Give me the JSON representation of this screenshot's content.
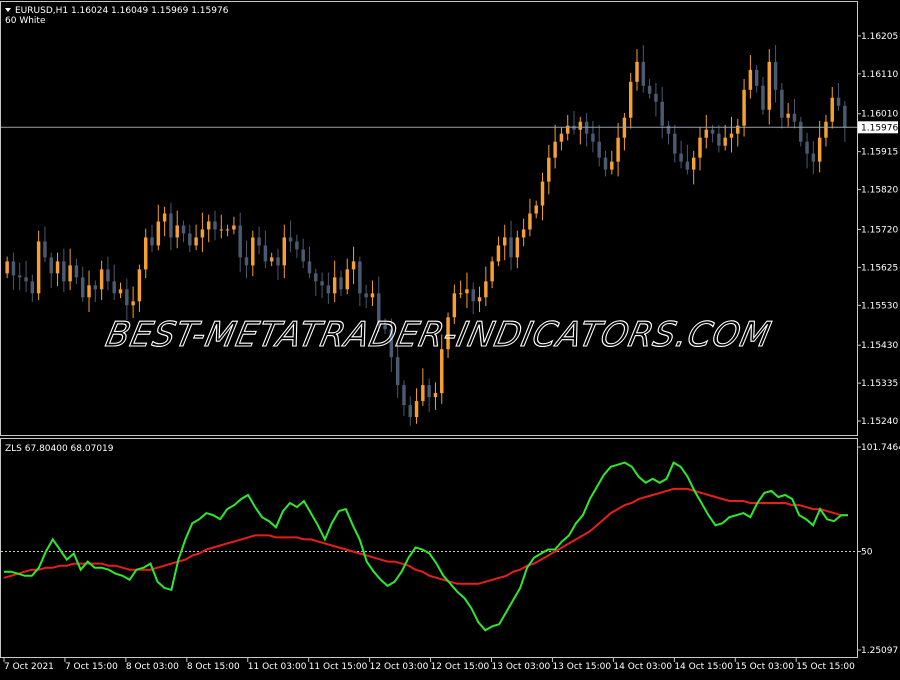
{
  "main_panel": {
    "symbol_header": "EURUSD,H1  1.16024 1.16049 1.15969 1.15976",
    "template_label": "60 White",
    "current_price": "1.15976",
    "price_line_value": 1.15976,
    "price_ticks": [
      "1.16205",
      "1.16110",
      "1.16010",
      "1.15915",
      "1.15820",
      "1.15720",
      "1.15625",
      "1.15530",
      "1.15430",
      "1.15335",
      "1.15240"
    ],
    "price_range": [
      1.15205,
      1.1629
    ],
    "watermark": "BEST-METATRADER-INDICATORS.COM"
  },
  "indicator_panel": {
    "label": "ZLS 67.80400 68.07019",
    "ticks": [
      "101.74647",
      "50",
      "1.25097"
    ],
    "range": [
      1.25097,
      101.74647
    ],
    "level": 50,
    "level_label": "50"
  },
  "time_axis": {
    "labels": [
      "7 Oct 2021",
      "7 Oct 15:00",
      "8 Oct 03:00",
      "8 Oct 15:00",
      "11 Oct 03:00",
      "11 Oct 15:00",
      "12 Oct 03:00",
      "12 Oct 15:00",
      "13 Oct 03:00",
      "13 Oct 15:00",
      "14 Oct 03:00",
      "14 Oct 15:00",
      "15 Oct 03:00",
      "15 Oct 15:00"
    ]
  },
  "colors": {
    "background": "#000000",
    "bull_candle": "#f5a030",
    "bear_candle": "#4a5a70",
    "grid_frame": "#c8c8c8",
    "text": "#ffffff",
    "zls_fast": "#2ee82e",
    "zls_slow": "#e61e1e",
    "watermark": "#ffffff"
  },
  "chart_data": [
    {
      "type": "candlestick",
      "title": "EURUSD,H1",
      "candles_close": [
        1.1564,
        1.15605,
        1.156,
        1.1559,
        1.1556,
        1.1569,
        1.1565,
        1.1561,
        1.1564,
        1.1559,
        1.1563,
        1.156,
        1.1555,
        1.1558,
        1.1557,
        1.1562,
        1.1559,
        1.1556,
        1.1557,
        1.1553,
        1.1554,
        1.1562,
        1.157,
        1.1568,
        1.1574,
        1.1576,
        1.157,
        1.1573,
        1.1571,
        1.1568,
        1.157,
        1.1572,
        1.1574,
        1.1572,
        1.1572,
        1.1572,
        1.1573,
        1.1565,
        1.1563,
        1.157,
        1.1568,
        1.1564,
        1.1565,
        1.1563,
        1.157,
        1.1569,
        1.1567,
        1.1564,
        1.1561,
        1.1559,
        1.1558,
        1.1556,
        1.156,
        1.1557,
        1.1562,
        1.1564,
        1.1556,
        1.1555,
        1.1556,
        1.1548,
        1.1547,
        1.154,
        1.1533,
        1.1528,
        1.1525,
        1.1529,
        1.1533,
        1.153,
        1.1531,
        1.1542,
        1.155,
        1.1556,
        1.1556,
        1.1557,
        1.1554,
        1.1555,
        1.1559,
        1.1564,
        1.1568,
        1.157,
        1.1565,
        1.157,
        1.1572,
        1.1576,
        1.1578,
        1.1584,
        1.159,
        1.1594,
        1.1596,
        1.1598,
        1.1597,
        1.1599,
        1.1596,
        1.1594,
        1.159,
        1.1587,
        1.1589,
        1.1595,
        1.16,
        1.1609,
        1.1614,
        1.1608,
        1.1606,
        1.1604,
        1.1598,
        1.1596,
        1.1591,
        1.1589,
        1.1587,
        1.159,
        1.1595,
        1.1597,
        1.1596,
        1.1593,
        1.1595,
        1.1596,
        1.1598,
        1.1607,
        1.1612,
        1.1608,
        1.1602,
        1.1614,
        1.1607,
        1.16,
        1.1601,
        1.1599,
        1.1594,
        1.1591,
        1.1589,
        1.1595,
        1.1599,
        1.1605,
        1.1603,
        1.15976
      ]
    },
    {
      "type": "line",
      "title": "ZLS",
      "series": [
        {
          "name": "ZLS fast",
          "values": [
            40,
            40,
            39,
            38,
            38,
            42,
            50,
            56,
            51,
            46,
            49,
            41,
            45,
            42,
            42,
            41,
            39,
            38,
            36,
            41,
            42,
            44,
            35,
            32,
            31,
            46,
            56,
            64,
            66,
            69,
            68,
            66,
            71,
            73,
            76,
            78,
            72,
            67,
            65,
            62,
            70,
            74,
            72,
            75,
            69,
            63,
            56,
            64,
            70,
            71,
            63,
            56,
            45,
            40,
            36,
            33,
            35,
            40,
            47,
            52,
            51,
            49,
            44,
            38,
            34,
            30,
            27,
            22,
            15,
            11,
            13,
            14,
            20,
            26,
            32,
            42,
            47,
            49,
            51,
            51,
            55,
            58,
            64,
            68,
            76,
            82,
            88,
            92,
            93,
            94,
            92,
            87,
            84,
            86,
            84,
            86,
            94,
            92,
            87,
            80,
            74,
            68,
            63,
            64,
            67,
            68,
            69,
            67,
            74,
            79,
            80,
            77,
            78,
            76,
            68,
            66,
            63,
            71,
            66,
            65,
            68,
            68
          ]
        },
        {
          "name": "ZLS slow",
          "values": [
            37,
            38,
            39,
            40,
            41,
            41,
            42,
            42,
            43,
            43,
            44,
            44,
            44,
            44,
            44,
            43,
            43,
            42,
            41,
            41,
            41,
            41,
            42,
            43,
            44,
            45,
            46,
            48,
            49,
            51,
            52,
            53,
            54,
            55,
            56,
            57,
            58,
            58,
            58,
            57,
            57,
            57,
            57,
            56,
            56,
            55,
            54,
            53,
            52,
            51,
            50,
            49,
            48,
            47,
            46,
            45,
            45,
            44,
            43,
            41,
            40,
            38,
            37,
            36,
            35,
            34,
            34,
            34,
            34,
            35,
            36,
            37,
            38,
            40,
            41,
            43,
            44,
            46,
            48,
            50,
            52,
            54,
            56,
            58,
            60,
            63,
            66,
            69,
            71,
            73,
            74,
            76,
            77,
            78,
            79,
            80,
            81,
            81,
            81,
            80,
            79,
            78,
            77,
            76,
            75,
            75,
            75,
            74,
            74,
            74,
            74,
            74,
            74,
            73,
            73,
            72,
            71,
            71,
            70,
            69,
            68,
            68
          ]
        }
      ],
      "ylim": [
        1.25097,
        101.74647
      ]
    }
  ]
}
